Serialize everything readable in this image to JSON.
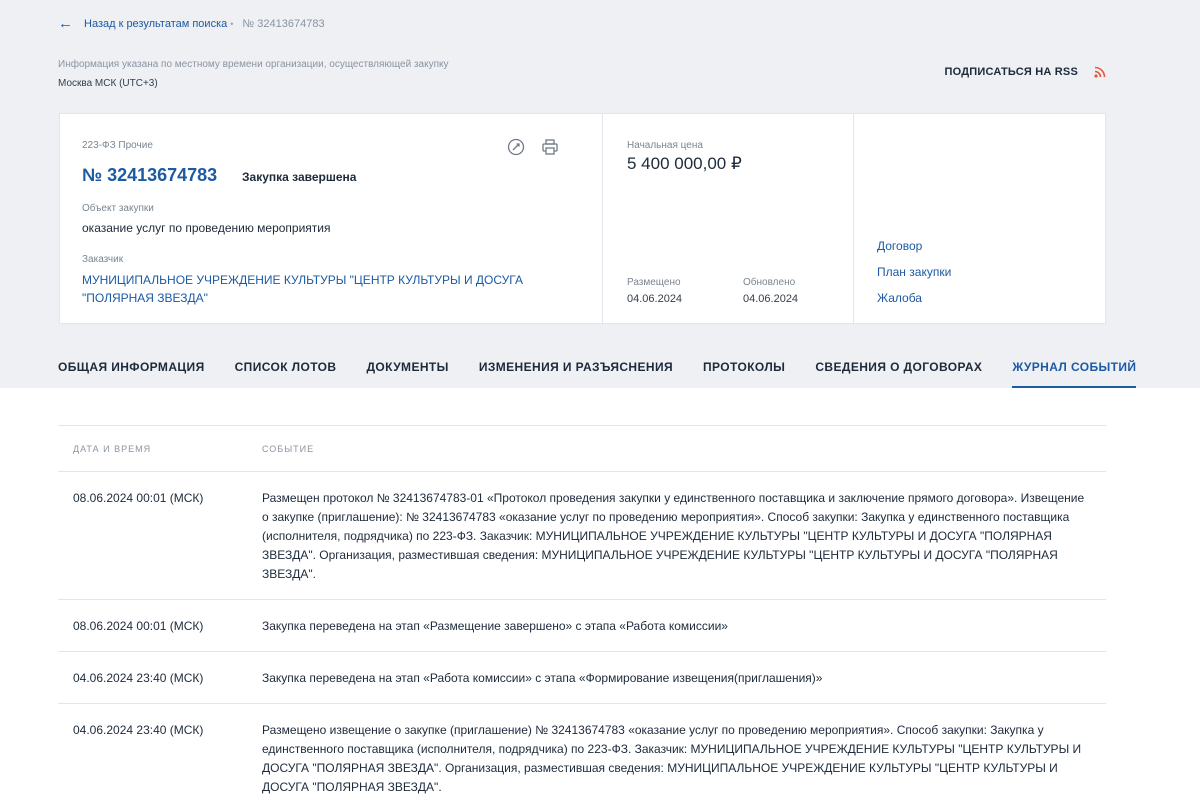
{
  "nav": {
    "back_label": "Назад к результатам поиска",
    "separator": "•",
    "current": "№ 32413674783"
  },
  "info": {
    "note": "Информация указана по местному времени организации, осуществляющей закупку",
    "timezone": "Москва МСК (UTC+3)"
  },
  "rss": {
    "label": "ПОДПИСАТЬСЯ НА RSS"
  },
  "procurement": {
    "law": "223-ФЗ Прочие",
    "number": "№ 32413674783",
    "status": "Закупка завершена",
    "object_label": "Объект закупки",
    "object_value": "оказание услуг по проведению мероприятия",
    "customer_label": "Заказчик",
    "customer_value": "МУНИЦИПАЛЬНОЕ УЧРЕЖДЕНИЕ КУЛЬТУРЫ \"ЦЕНТР КУЛЬТУРЫ И ДОСУГА \"ПОЛЯРНАЯ ЗВЕЗДА\"",
    "price_label": "Начальная цена",
    "price_value": "5 400 000,00 ₽",
    "published_label": "Размещено",
    "published_value": "04.06.2024",
    "updated_label": "Обновлено",
    "updated_value": "04.06.2024",
    "links": [
      "Договор",
      "План закупки",
      "Жалоба"
    ]
  },
  "tabs": [
    "ОБЩАЯ ИНФОРМАЦИЯ",
    "СПИСОК ЛОТОВ",
    "ДОКУМЕНТЫ",
    "ИЗМЕНЕНИЯ И РАЗЪЯСНЕНИЯ",
    "ПРОТОКОЛЫ",
    "СВЕДЕНИЯ О ДОГОВОРАХ",
    "ЖУРНАЛ СОБЫТИЙ"
  ],
  "active_tab": "ЖУРНАЛ СОБЫТИЙ",
  "events": {
    "columns": [
      "ДАТА И ВРЕМЯ",
      "СОБЫТИЕ"
    ],
    "rows": [
      {
        "date": "08.06.2024 00:01 (МСК)",
        "text": "Размещен протокол № 32413674783-01 «Протокол проведения закупки у единственного поставщика и заключение прямого договора». Извещение о закупке (приглашение): № 32413674783 «оказание услуг по проведению мероприятия». Способ закупки: Закупка у единственного поставщика (исполнителя, подрядчика) по 223-ФЗ. Заказчик: МУНИЦИПАЛЬНОЕ УЧРЕЖДЕНИЕ КУЛЬТУРЫ \"ЦЕНТР КУЛЬТУРЫ И ДОСУГА \"ПОЛЯРНАЯ ЗВЕЗДА\". Организация, разместившая сведения: МУНИЦИПАЛЬНОЕ УЧРЕЖДЕНИЕ КУЛЬТУРЫ \"ЦЕНТР КУЛЬТУРЫ И ДОСУГА \"ПОЛЯРНАЯ ЗВЕЗДА\"."
      },
      {
        "date": "08.06.2024 00:01 (МСК)",
        "text": "Закупка переведена на этап «Размещение завершено» с этапа «Работа комиссии»"
      },
      {
        "date": "04.06.2024 23:40 (МСК)",
        "text": "Закупка переведена на этап «Работа комиссии» с этапа «Формирование извещения(приглашения)»"
      },
      {
        "date": "04.06.2024 23:40 (МСК)",
        "text": "Размещено извещение о закупке (приглашение) № 32413674783 «оказание услуг по проведению мероприятия». Способ закупки: Закупка у единственного поставщика (исполнителя, подрядчика) по 223-ФЗ. Заказчик: МУНИЦИПАЛЬНОЕ УЧРЕЖДЕНИЕ КУЛЬТУРЫ \"ЦЕНТР КУЛЬТУРЫ И ДОСУГА \"ПОЛЯРНАЯ ЗВЕЗДА\". Организация, разместившая сведения: МУНИЦИПАЛЬНОЕ УЧРЕЖДЕНИЕ КУЛЬТУРЫ \"ЦЕНТР КУЛЬТУРЫ И ДОСУГА \"ПОЛЯРНАЯ ЗВЕЗДА\"."
      }
    ]
  },
  "icons": {
    "back": "arrow-left-icon",
    "rss": "rss-icon",
    "link": "link-icon",
    "print": "print-icon"
  },
  "colors": {
    "accent": "#1c5aa3",
    "rss": "#e8573b",
    "header_bg": "#eef0f4"
  }
}
